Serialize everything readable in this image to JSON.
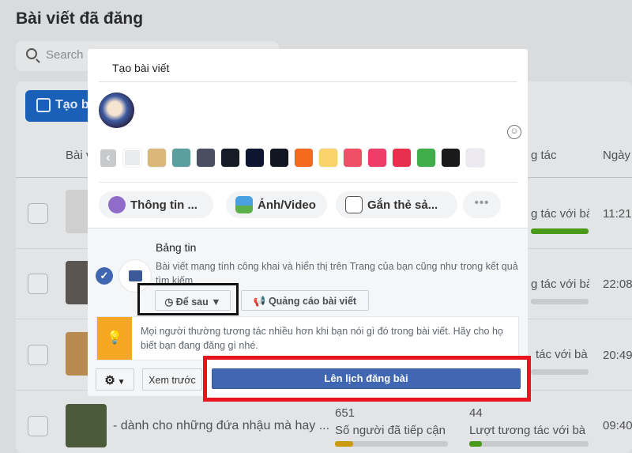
{
  "page": {
    "title": "Bài viết đã đăng",
    "search_placeholder": "Search",
    "create_label": "Tạo b",
    "col_post": "Bài v",
    "col_interactions": "g tác",
    "col_date": "Ngày",
    "rows": [
      {
        "interaction_label": "g tác với bà",
        "time": "11:21",
        "bar_color": "#4a9a1a",
        "bar_fill": 1.0
      },
      {
        "interaction_label": "g tác với bà",
        "time": "22:08",
        "bar_color": "#c9cacc",
        "bar_fill": 0
      },
      {
        "interaction_label": "tác với bà",
        "time": "20:49",
        "bar_color": "#c9cacc",
        "bar_fill": 0
      },
      {
        "text": "- dành cho những đứa nhậu mà hay ...",
        "reach": "651",
        "reach_label": "Số người đã tiếp cận",
        "interactions": "44",
        "interaction_label": "Lượt tương tác với bà",
        "time": "09:40"
      }
    ]
  },
  "modal": {
    "tab": "Tạo bài viết",
    "swatch_colors": [
      "#e9ebee",
      "#d9b87a",
      "#5a9ea0",
      "#4a4e60",
      "#161b26",
      "#0d1530",
      "#121620",
      "#f56a1f",
      "#fad36a",
      "#ef5068",
      "#ec3e68",
      "#e8304c",
      "#3fae4a",
      "#1a1a1a",
      "#eceaf0"
    ],
    "actions": [
      "Thông tin ...",
      "Ảnh/Video",
      "Gắn thẻ sả..."
    ],
    "feed_title": "Bảng tin",
    "feed_desc": "Bài viết mang tính công khai và hiển thị trên Trang của bạn cũng như trong kết quả tìm kiếm",
    "schedule_dropdown": "Để sau",
    "boost": "Quảng cáo bài viết",
    "tip": "Mọi người thường tương tác nhiều hơn khi bạn nói gì đó trong bài viết. Hãy cho họ biết bạn đang đăng gì nhé.",
    "preview": "Xem trước",
    "submit": "Lên lịch đăng bài",
    "accent": "#4267b2",
    "highlight": "#e8141e"
  }
}
